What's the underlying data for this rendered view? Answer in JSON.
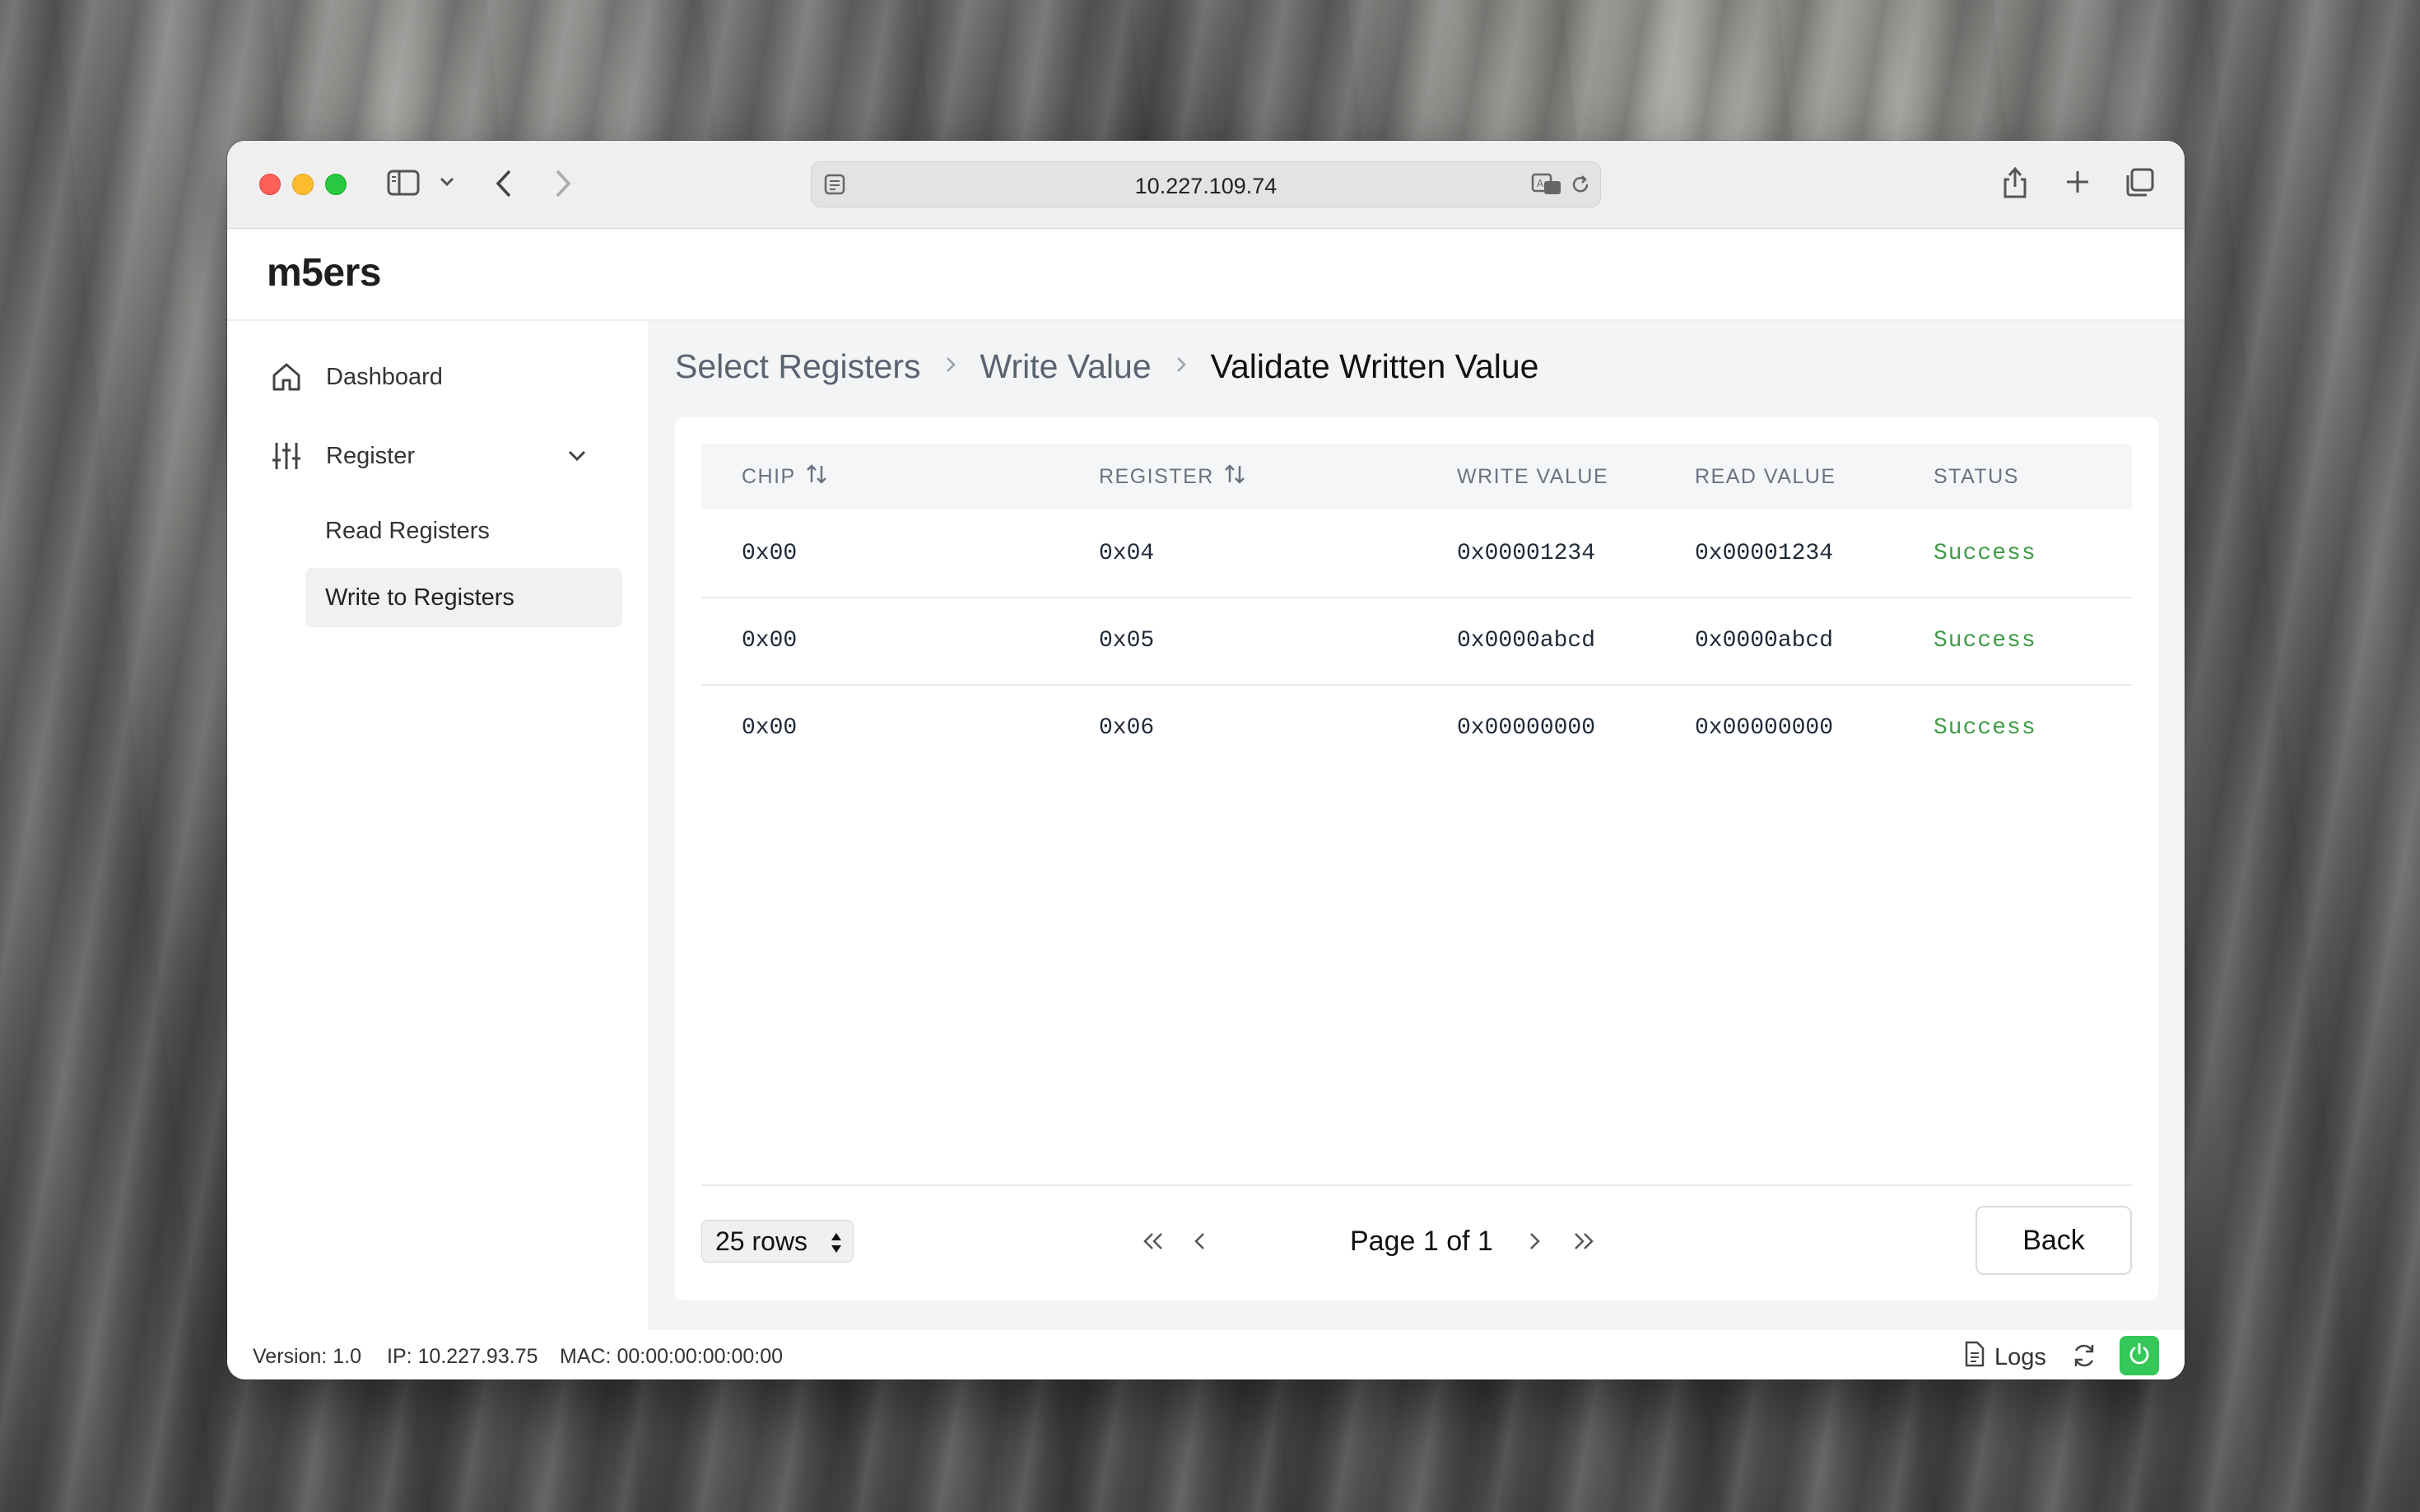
{
  "browser": {
    "url": "10.227.109.74"
  },
  "app": {
    "brand": "m5ers"
  },
  "sidebar": {
    "dashboard_label": "Dashboard",
    "register_label": "Register",
    "sub_items": [
      {
        "label": "Read Registers",
        "active": false
      },
      {
        "label": "Write to Registers",
        "active": true
      }
    ]
  },
  "breadcrumb": {
    "step1": "Select Registers",
    "step2": "Write Value",
    "step3": "Validate Written Value"
  },
  "table": {
    "headers": [
      "CHIP",
      "REGISTER",
      "WRITE VALUE",
      "READ VALUE",
      "STATUS"
    ],
    "rows": [
      [
        "0x00",
        "0x04",
        "0x00001234",
        "0x00001234",
        "Success"
      ],
      [
        "0x00",
        "0x05",
        "0x0000abcd",
        "0x0000abcd",
        "Success"
      ],
      [
        "0x00",
        "0x06",
        "0x00000000",
        "0x00000000",
        "Success"
      ]
    ],
    "status_color": "#3f9b48"
  },
  "pagination": {
    "rows_per_page": "25 rows",
    "page_label": "Page 1 of 1"
  },
  "actions": {
    "back_label": "Back"
  },
  "statusbar": {
    "version": "Version: 1.0",
    "ip": "IP: 10.227.93.75",
    "mac": "MAC: 00:00:00:00:00:00",
    "logs_label": "Logs",
    "power_color": "#34c759"
  }
}
